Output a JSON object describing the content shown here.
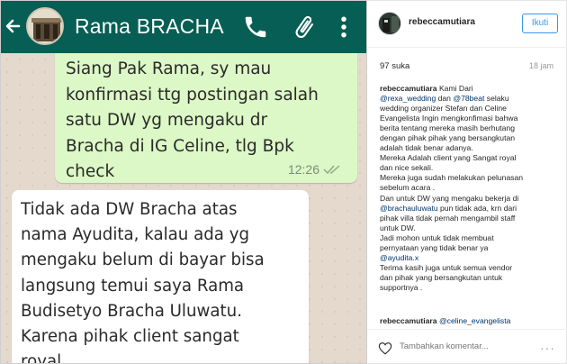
{
  "whatsapp": {
    "contact_name": "Rama BRACHA",
    "outgoing": {
      "lines": [
        "Siang Pak Rama, sy mau",
        "konfirmasi ttg postingan salah",
        "satu DW yg mengaku dr",
        "Bracha di IG Celine, tlg Bpk",
        "check"
      ],
      "time": "12:26"
    },
    "incoming": {
      "lines": [
        "Tidak ada DW Bracha atas",
        "nama Ayudita, kalau ada yg",
        "mengaku belum di bayar bisa",
        "langsung temui saya Rama",
        "Budisetyo Bracha Uluwatu.",
        "Karena pihak client sangat",
        "royal"
      ]
    },
    "colors": {
      "header": "#075e54",
      "outgoing_bubble": "#dcf8c6",
      "incoming_bubble": "#ffffff"
    },
    "icons": [
      "back-arrow-icon",
      "phone-icon",
      "attachment-icon",
      "more-vertical-icon"
    ]
  },
  "instagram": {
    "username": "rebeccamutiara",
    "follow_label": "Ikuti",
    "likes": "97 suka",
    "date": "18 jam",
    "caption": {
      "user": "rebeccamutiara",
      "first_text": "Kami Dari",
      "mention_1": "@rexa_wedding",
      "mid_text": "dan",
      "mention_2": "@78beat",
      "end_text": "selaku",
      "lines": [
        "wedding organizer Stefan dan Celine",
        "Evangelista Ingin mengkonfimasi bahwa",
        "berita tentang mereka masih berhutang",
        "dengan pihak pihak yang bersangkutan",
        "adalah tidak benar adanya.",
        "Mereka Adalah client yang Sangat royal",
        "dan nice sekali.",
        "Mereka juga sudah melakukan pelunasan",
        "sebelum acara .",
        "Dan untuk DW yang mengaku bekerja di"
      ],
      "mention_3": "@brachauluwatu",
      "line_after_mention_3": "pun tidak ada, krn dari",
      "lines_2": [
        "pihak villa tidak pernah mengambil staff",
        "untuk DW.",
        "Jadi mohon untuk tidak membuat",
        "pernyataan yang tidak benar ya"
      ],
      "mention_4": "@ayudita.x",
      "lines_3": [
        "Terima kasih juga untuk semua vendor",
        "dan pihak yang bersangkutan untuk",
        "supportnya ."
      ]
    },
    "comment": {
      "user": "rebeccamutiara",
      "mention": "@celine_evangelista"
    },
    "comment_placeholder": "Tambahkan komentar...",
    "more_label": "···",
    "colors": {
      "follow": "#3897f0",
      "link": "#003569"
    },
    "icons": [
      "heart-icon"
    ]
  }
}
